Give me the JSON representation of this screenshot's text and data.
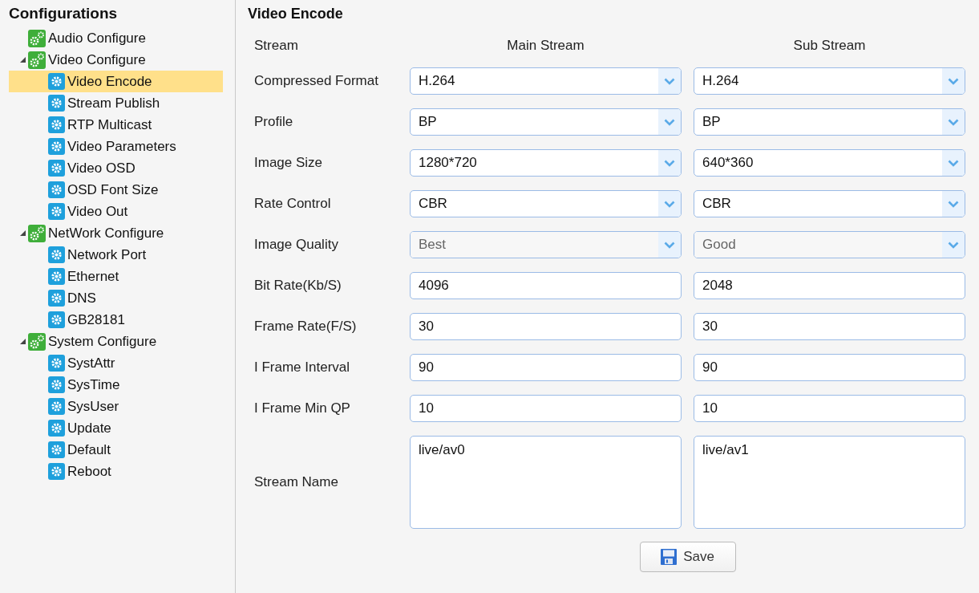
{
  "sidebar": {
    "title": "Configurations",
    "items": [
      {
        "label": "Audio Configure",
        "kind": "group",
        "selected": false
      },
      {
        "label": "Video Configure",
        "kind": "group",
        "selected": false,
        "expanded": true,
        "children": [
          {
            "label": "Video Encode",
            "kind": "page",
            "selected": true
          },
          {
            "label": "Stream Publish",
            "kind": "page",
            "selected": false
          },
          {
            "label": "RTP Multicast",
            "kind": "page",
            "selected": false
          },
          {
            "label": "Video Parameters",
            "kind": "page",
            "selected": false
          },
          {
            "label": "Video OSD",
            "kind": "page",
            "selected": false
          },
          {
            "label": "OSD Font Size",
            "kind": "page",
            "selected": false
          },
          {
            "label": "Video Out",
            "kind": "page",
            "selected": false
          }
        ]
      },
      {
        "label": "NetWork Configure",
        "kind": "group",
        "selected": false,
        "expanded": true,
        "children": [
          {
            "label": "Network Port",
            "kind": "page",
            "selected": false
          },
          {
            "label": "Ethernet",
            "kind": "page",
            "selected": false
          },
          {
            "label": "DNS",
            "kind": "page",
            "selected": false
          },
          {
            "label": "GB28181",
            "kind": "page",
            "selected": false
          }
        ]
      },
      {
        "label": "System Configure",
        "kind": "group",
        "selected": false,
        "expanded": true,
        "children": [
          {
            "label": "SystAttr",
            "kind": "page",
            "selected": false
          },
          {
            "label": "SysTime",
            "kind": "page",
            "selected": false
          },
          {
            "label": "SysUser",
            "kind": "page",
            "selected": false
          },
          {
            "label": "Update",
            "kind": "page",
            "selected": false
          },
          {
            "label": "Default",
            "kind": "page",
            "selected": false
          },
          {
            "label": "Reboot",
            "kind": "page",
            "selected": false
          }
        ]
      }
    ]
  },
  "form": {
    "title": "Video Encode",
    "header": {
      "label": "Stream",
      "columns": [
        "Main Stream",
        "Sub Stream"
      ]
    },
    "rows": [
      {
        "label": "Compressed Format",
        "kind": "select",
        "disabled": false,
        "values": [
          "H.264",
          "H.264"
        ]
      },
      {
        "label": "Profile",
        "kind": "select",
        "disabled": false,
        "values": [
          "BP",
          "BP"
        ]
      },
      {
        "label": "Image Size",
        "kind": "select",
        "disabled": false,
        "values": [
          "1280*720",
          "640*360"
        ]
      },
      {
        "label": "Rate Control",
        "kind": "select",
        "disabled": false,
        "values": [
          "CBR",
          "CBR"
        ]
      },
      {
        "label": "Image Quality",
        "kind": "select",
        "disabled": true,
        "values": [
          "Best",
          "Good"
        ]
      },
      {
        "label": "Bit Rate(Kb/S)",
        "kind": "text",
        "disabled": false,
        "values": [
          "4096",
          "2048"
        ]
      },
      {
        "label": "Frame Rate(F/S)",
        "kind": "text",
        "disabled": false,
        "values": [
          "30",
          "30"
        ]
      },
      {
        "label": "I Frame Interval",
        "kind": "text",
        "disabled": false,
        "values": [
          "90",
          "90"
        ]
      },
      {
        "label": "I Frame Min QP",
        "kind": "text",
        "disabled": false,
        "values": [
          "10",
          "10"
        ]
      },
      {
        "label": "Stream Name",
        "kind": "textarea",
        "disabled": false,
        "values": [
          "live/av0",
          "live/av1"
        ]
      }
    ],
    "save_button": "Save"
  }
}
